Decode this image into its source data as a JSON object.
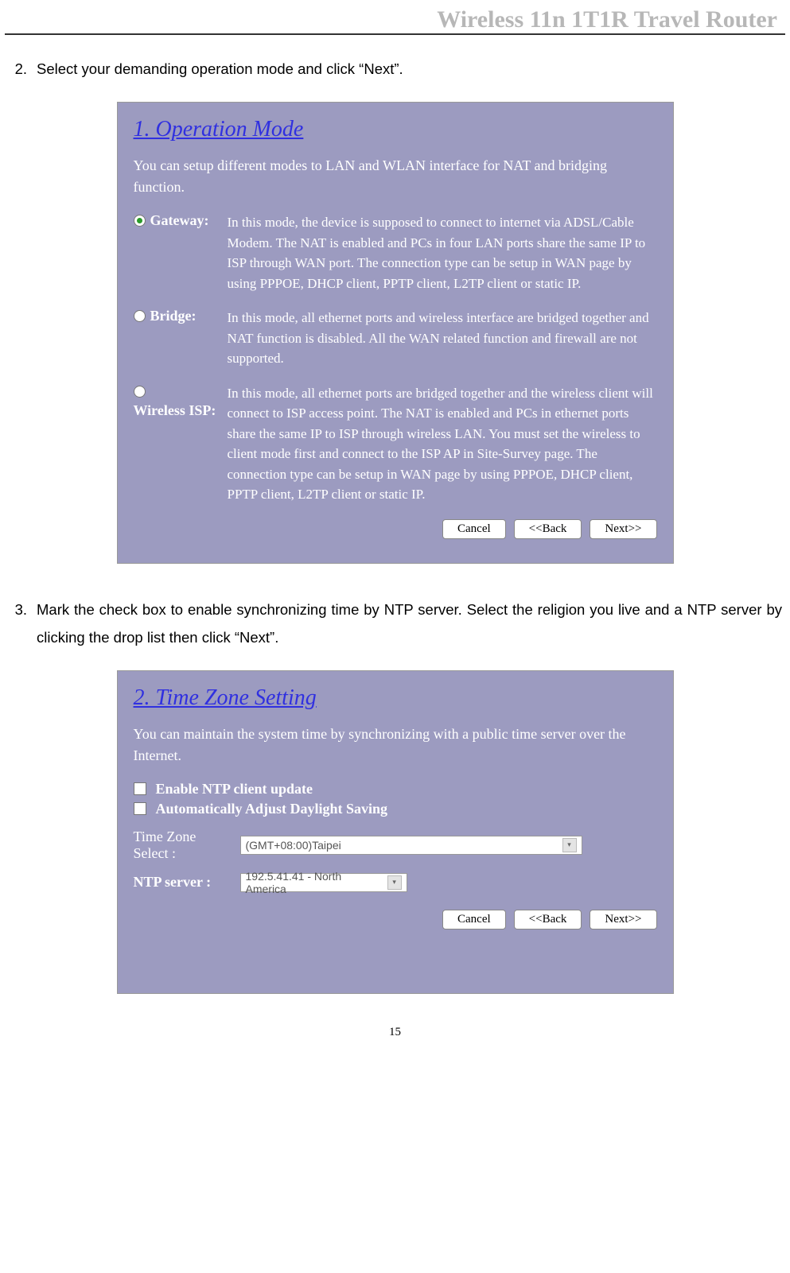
{
  "header": {
    "title": "Wireless 11n 1T1R Travel Router"
  },
  "steps": {
    "s2": {
      "num": "2.",
      "text": "Select your demanding operation mode and click “Next”."
    },
    "s3": {
      "num": "3.",
      "text": "Mark the check box to enable synchronizing time by NTP server. Select the religion you live and a NTP server by clicking the drop list then click “Next”."
    }
  },
  "screenshot1": {
    "heading": "1. Operation Mode",
    "intro": "You can setup different modes to LAN and WLAN interface for NAT and bridging function.",
    "modes": {
      "gateway": {
        "label": "Gateway:",
        "desc": "In this mode, the device is supposed to connect to internet via ADSL/Cable Modem. The NAT is enabled and PCs in four LAN ports share the same IP to ISP through WAN port. The connection type can be setup in WAN page by using PPPOE, DHCP client, PPTP client, L2TP client or static IP."
      },
      "bridge": {
        "label": "Bridge:",
        "desc": "In this mode, all ethernet ports and wireless interface are bridged together and NAT function is disabled. All the WAN related function and firewall are not supported."
      },
      "wisp": {
        "label": "Wireless ISP:",
        "desc": "In this mode, all ethernet ports are bridged together and the wireless client will connect to ISP access point. The NAT is enabled and PCs in ethernet ports share the same IP to ISP through wireless LAN. You must set the wireless to client mode first and connect to the ISP AP in Site-Survey page. The connection type can be setup in WAN page by using PPPOE, DHCP client, PPTP client, L2TP client or static IP."
      }
    },
    "buttons": {
      "cancel": "Cancel",
      "back": "<<Back",
      "next": "Next>>"
    }
  },
  "screenshot2": {
    "heading": "2. Time Zone Setting",
    "intro": "You can maintain the system time by synchronizing with a public time server over the Internet.",
    "checkboxes": {
      "ntp": "Enable NTP client update",
      "dst": "Automatically Adjust Daylight Saving"
    },
    "fields": {
      "tz_label": "Time Zone Select :",
      "tz_value": "(GMT+08:00)Taipei",
      "ntp_label": "NTP server :",
      "ntp_value": "192.5.41.41 - North America"
    },
    "buttons": {
      "cancel": "Cancel",
      "back": "<<Back",
      "next": "Next>>"
    }
  },
  "page_number": "15"
}
